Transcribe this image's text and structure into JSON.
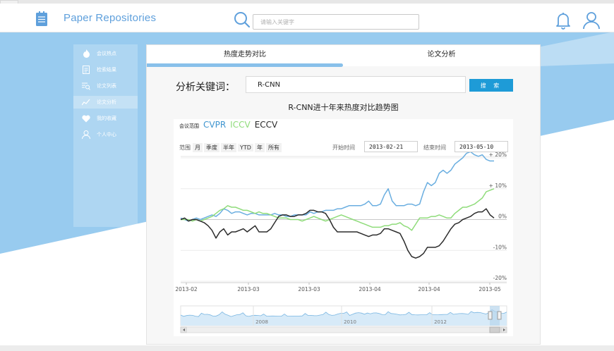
{
  "colors": {
    "accent": "#5fa0dc",
    "bg_blue": "#98cbef",
    "cvpr": "#6aaee0",
    "iccv": "#8fdc7a",
    "eccv": "#2b2b2b",
    "button": "#1e9bd7"
  },
  "header": {
    "brand": "Paper Repositories",
    "search_placeholder": "请输入关键字",
    "icons": [
      "document-icon",
      "search-icon",
      "bell-icon",
      "user-icon"
    ]
  },
  "sidebar": {
    "items": [
      {
        "label": "会议热点",
        "icon": "flame-icon",
        "active": false
      },
      {
        "label": "检索结果",
        "icon": "list-doc-icon",
        "active": false
      },
      {
        "label": "论文列表",
        "icon": "search-list-icon",
        "active": false
      },
      {
        "label": "论文分析",
        "icon": "analysis-icon",
        "active": true
      },
      {
        "label": "我的收藏",
        "icon": "heart-icon",
        "active": false
      },
      {
        "label": "个人中心",
        "icon": "person-icon",
        "active": false
      }
    ]
  },
  "main": {
    "tabs": [
      {
        "label": "热度走势对比",
        "active": true
      },
      {
        "label": "论文分析",
        "active": false
      }
    ],
    "keyword_label": "分析关键词：",
    "keyword_value": "R-CNN",
    "search_button": "搜 索",
    "chart_title": "R-CNN进十年来热度对比趋势图"
  },
  "chart_controls": {
    "legend_caption": "会议范围",
    "range_label": "范围",
    "range_buttons": [
      "月",
      "季度",
      "半年",
      "YTD",
      "年",
      "所有"
    ],
    "start_label": "开始时间",
    "start_value": "2013-02-21",
    "end_label": "结束时间",
    "end_value": "2013-05-10"
  },
  "chart_data": {
    "type": "line",
    "title": "R-CNN进十年来热度对比趋势图",
    "x_tick_labels": [
      "2013-02",
      "2013-03",
      "2013-03",
      "2013-04",
      "2013-04",
      "2013-05"
    ],
    "y_tick_labels": [
      "+ 20%",
      "+ 10%",
      "0%",
      "-10%",
      "-20%"
    ],
    "ylim": [
      -20,
      20
    ],
    "series": [
      {
        "name": "CVPR",
        "color": "#6aaee0",
        "values": [
          0.5,
          0,
          -0.5,
          0,
          0.5,
          0,
          0.5,
          1,
          1.5,
          1,
          2,
          3.5,
          3,
          2,
          2.5,
          2.5,
          2,
          1.5,
          2,
          2,
          1.5,
          1.5,
          1.5,
          1.5,
          2,
          1.5,
          1.5,
          1,
          1,
          1.5,
          1.5,
          1.5,
          1.5,
          2.5,
          2,
          2.5,
          2.5,
          3,
          3,
          3,
          3.5,
          3.5,
          4,
          4.5,
          4.5,
          4.5,
          4.5,
          5,
          6,
          4.5,
          4.5,
          5,
          8,
          10,
          6,
          4.5,
          4.5,
          4.5,
          5,
          5,
          4.5,
          5,
          9,
          12,
          11,
          12,
          15,
          16,
          15,
          16,
          18,
          19,
          20,
          21.5,
          22,
          21,
          20.5,
          21,
          19.5,
          19,
          19
        ]
      },
      {
        "name": "ICCV",
        "color": "#8fdc7a",
        "values": [
          0,
          0,
          0,
          -0.5,
          0,
          -0.5,
          0,
          0.5,
          1,
          2,
          3,
          3.5,
          4.5,
          4,
          4,
          3.5,
          3,
          3,
          2.5,
          2,
          2.5,
          2,
          2,
          1.5,
          1,
          0.5,
          0.5,
          0.5,
          0,
          0,
          0,
          -0.5,
          0,
          0.5,
          1,
          0.5,
          0,
          -0.5,
          0,
          0.5,
          1,
          1.5,
          1,
          0.5,
          0,
          -0.5,
          -1,
          -1.5,
          -2,
          -2.5,
          -2.5,
          -2.5,
          -2,
          -2,
          -1.5,
          -1.5,
          -1,
          -2,
          -2.5,
          -3.5,
          -1.5,
          0.5,
          0.5,
          0.5,
          1,
          1,
          1.5,
          1,
          0.5,
          0.5,
          2,
          3,
          4,
          4,
          4.5,
          5,
          6,
          7,
          9,
          9.5,
          10
        ]
      },
      {
        "name": "ECCV",
        "color": "#2b2b2b",
        "values": [
          0,
          0.5,
          -0.5,
          0,
          0,
          -0.5,
          -1,
          -2,
          -3.5,
          -6,
          -4,
          -3,
          -5,
          -4,
          -4,
          -3.5,
          -3,
          -4,
          -3,
          -2,
          -4,
          -4,
          -4,
          -3,
          -1,
          1,
          1.5,
          1.5,
          1,
          1,
          1.5,
          1.5,
          2,
          3,
          3,
          2.5,
          2.5,
          2,
          0,
          -2.5,
          -4,
          -4,
          -4,
          -4,
          -4,
          -4,
          -4.5,
          -5,
          -5.5,
          -5,
          -5,
          -4.5,
          -3,
          -3,
          -3.5,
          -4,
          -4.5,
          -7,
          -10,
          -12,
          -12.5,
          -12,
          -11,
          -9,
          -9,
          -9,
          -8.5,
          -7,
          -5,
          -3,
          -1.5,
          -1,
          0,
          0.5,
          1,
          2,
          2.5,
          2.5,
          3.5,
          1.5,
          0.5
        ]
      }
    ],
    "navigator": {
      "labels": [
        "2008",
        "2010",
        "2012"
      ]
    }
  }
}
